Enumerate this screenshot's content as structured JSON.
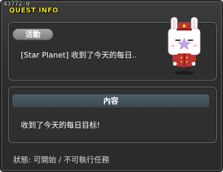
{
  "window": {
    "quest_id": "43772-0",
    "title": "QUEST INFO"
  },
  "activity": {
    "badge_label": "活動",
    "text": "[Star Planet] 收到了今天的每日.."
  },
  "content": {
    "header": "內容",
    "text": "收到了今天的每日目标!"
  },
  "status": {
    "text": "狀態: 可開始 / 不可執行任務"
  },
  "npc": {
    "icon": "rabbit-bellhop-npc"
  },
  "colors": {
    "title": "#f2e51e",
    "panel_bg": "#2f2f2f",
    "window_bg": "#2d2d2d",
    "header_bar": "#46545b"
  }
}
